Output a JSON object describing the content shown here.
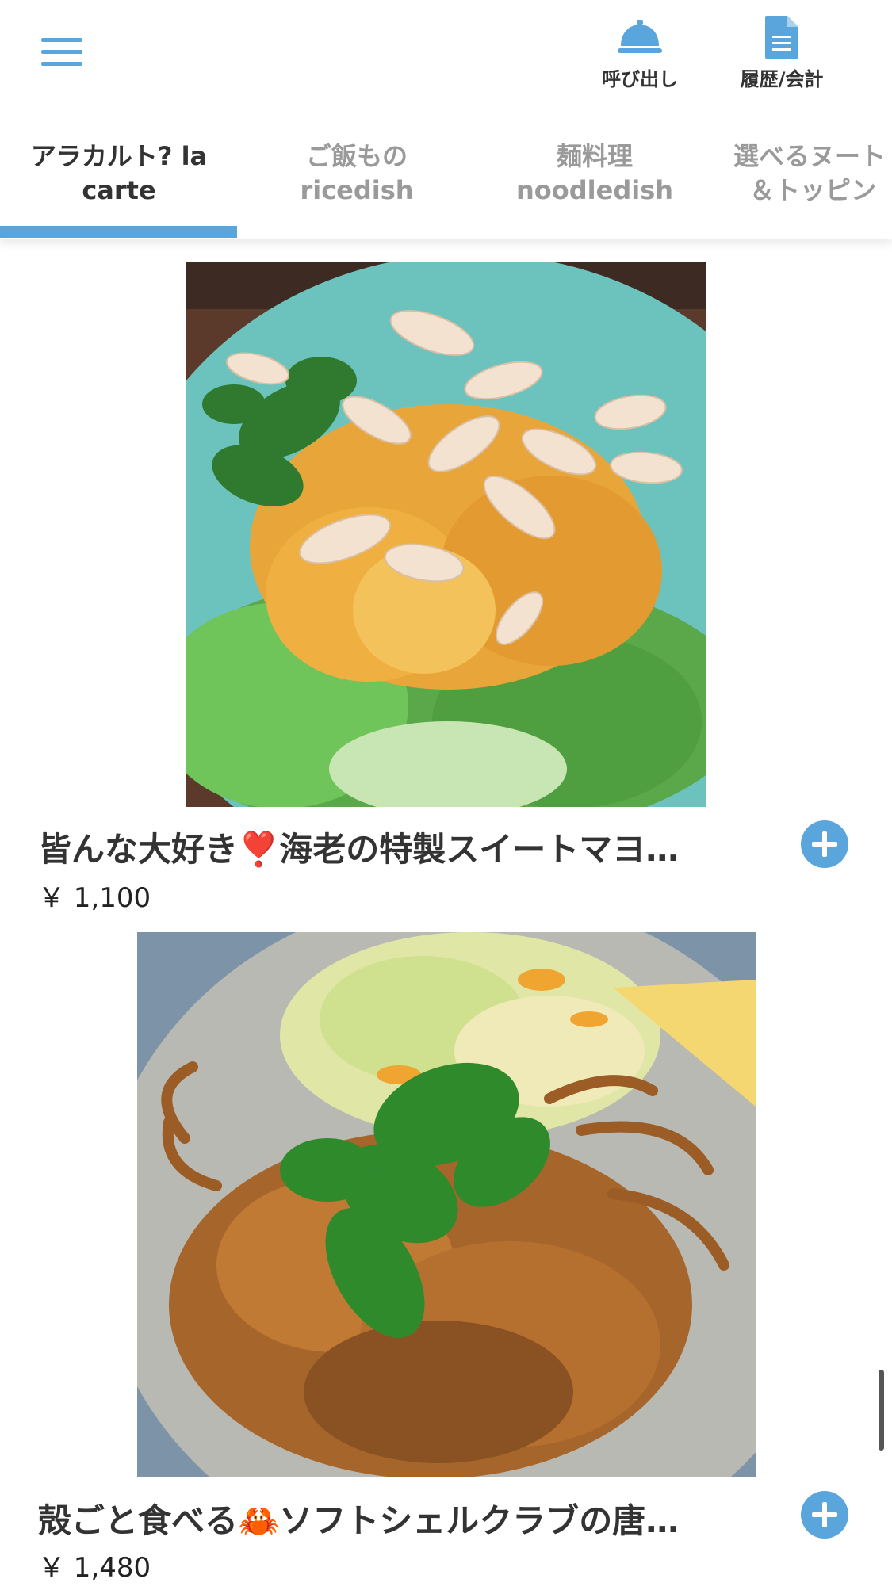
{
  "header": {
    "menu_icon": "hamburger-menu-icon",
    "call_label": "呼び出し",
    "call_icon": "service-bell-icon",
    "history_label": "履歴/会計",
    "history_icon": "document-icon",
    "accent": "#5aa5dc"
  },
  "tabs": [
    {
      "line1": "アラカルト? la",
      "line2": "carte",
      "active": true
    },
    {
      "line1": "ご飯もの",
      "line2": "ricedish",
      "active": false
    },
    {
      "line1": "麺料理",
      "line2": "noodledish",
      "active": false
    },
    {
      "line1": "選べるヌート",
      "line2": "＆トッピン",
      "active": false
    }
  ],
  "items": [
    {
      "name": "皆んな大好き❣️海老の特製スイートマヨ…",
      "price": "￥ 1,100",
      "photo": "shrimp-mayo-photo"
    },
    {
      "name": "殻ごと食べる🦀ソフトシェルクラブの唐…",
      "price": "￥ 1,480",
      "photo": "soft-shell-crab-photo"
    }
  ]
}
